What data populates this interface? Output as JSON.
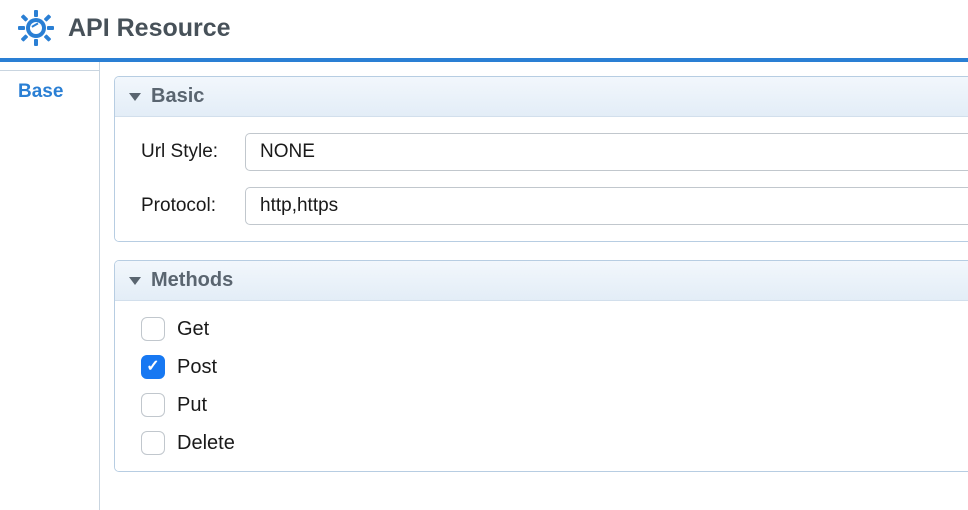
{
  "header": {
    "title": "API Resource"
  },
  "tabs": {
    "base": "Base"
  },
  "sections": {
    "basic": {
      "title": "Basic",
      "urlStyle": {
        "label": "Url Style:",
        "value": "NONE"
      },
      "protocol": {
        "label": "Protocol:",
        "value": "http,https"
      }
    },
    "methods": {
      "title": "Methods",
      "items": [
        {
          "label": "Get",
          "checked": false
        },
        {
          "label": "Post",
          "checked": true
        },
        {
          "label": "Put",
          "checked": false
        },
        {
          "label": "Delete",
          "checked": false
        }
      ]
    }
  }
}
